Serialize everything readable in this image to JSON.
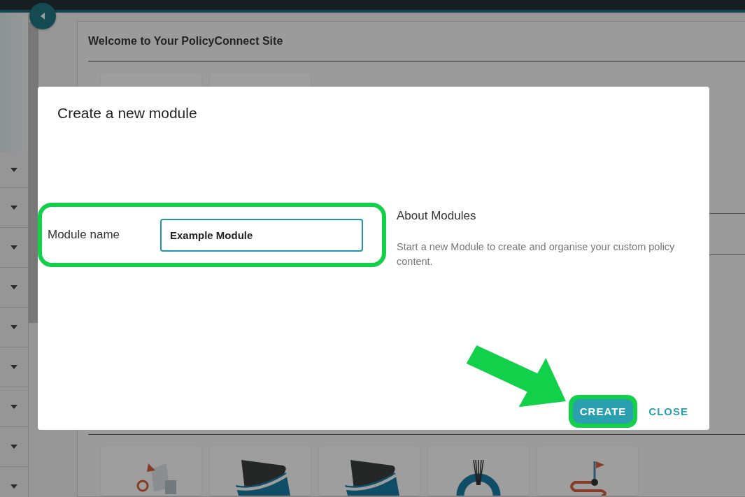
{
  "sidebar": {
    "items": [
      {
        "kind": "dropdown"
      },
      {
        "kind": "dropdown"
      },
      {
        "kind": "dropdown"
      },
      {
        "kind": "dropdown"
      },
      {
        "kind": "dropdown"
      },
      {
        "kind": "dropdown"
      },
      {
        "kind": "dropdown"
      },
      {
        "kind": "dropdown"
      },
      {
        "kind": "dropdown"
      }
    ]
  },
  "welcome_section": {
    "title": "Welcome to Your PolicyConnect Site",
    "tiles": [
      {
        "kind": "blank"
      },
      {
        "kind": "blank"
      }
    ]
  },
  "group_links": {
    "tiles": [
      {
        "kind": "documents"
      },
      {
        "kind": "swoosh"
      },
      {
        "kind": "swoosh"
      },
      {
        "kind": "ring"
      },
      {
        "kind": "route"
      }
    ]
  },
  "dialog": {
    "title": "Create a new module",
    "field": {
      "label": "Module name",
      "value": "Example Module"
    },
    "about": {
      "title": "About Modules",
      "text": "Start a new Module to create and organise your custom policy content."
    },
    "buttons": [
      {
        "label": "CREATE",
        "kind": "primary"
      },
      {
        "label": "CLOSE",
        "kind": "text"
      }
    ]
  },
  "annotations": [
    {
      "kind": "field-outline"
    },
    {
      "kind": "arrow"
    },
    {
      "kind": "button-outline"
    }
  ]
}
